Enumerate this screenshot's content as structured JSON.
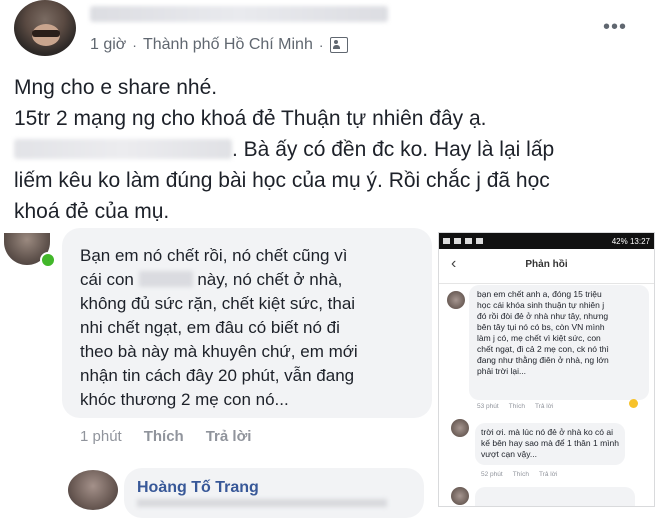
{
  "post": {
    "meta_time": "1 giờ",
    "meta_sep": "·",
    "meta_location": "Thành phố Hồ Chí Minh",
    "meta_sep2": "·",
    "more_icon": "more-dots-icon",
    "lines": [
      "Mng cho e share nhé.",
      "15tr 2 mạng ng cho khoá đẻ Thuận tự nhiên đây ạ.",
      ". Bà ấy có đền đc ko. Hay là lại lấp",
      "liếm kêu ko làm đúng bài học của mụ ý. Rồi chắc j đã học",
      "khoá đẻ của mụ."
    ]
  },
  "comment": {
    "line1": "Bạn em nó chết rồi, nó chết cũng vì",
    "line2_a": "cái con",
    "line2_b": " này, nó chết ở nhà,",
    "line3": "không đủ sức rặn, chết kiệt sức, thai",
    "line4": "nhi chết ngạt, em đâu có biết nó đi",
    "line5": "theo bà này mà khuyên chứ, em mới",
    "line6": "nhận tin cách đây 20 phút, vẫn đang",
    "line7": "khóc thương 2 mẹ con nó...",
    "time": "1 phút",
    "like": "Thích",
    "reply": "Trả lời"
  },
  "reply": {
    "name": "Hoàng Tố Trang"
  },
  "phone": {
    "status_right": "42% 13:27",
    "title": "Phản hồi",
    "c1_lines": [
      "bạn em chết anh a, đóng 15 triệu",
      "học cái khóa sinh thuận tự nhiên j",
      "đó rồi đòi đẻ ở nhà như tây, nhưng",
      "bên tây tụi nó có bs, còn VN mình",
      "làm j có, mẹ chết vì kiệt sức, con",
      "chết ngạt, đi cả 2 mẹ con, ck nó thì",
      "đang như thằng điên ở nhà, ng lớn",
      "phải trời lại..."
    ],
    "c1_time": "53 phút",
    "c1_like": "Thích",
    "c1_reply": "Trả lời",
    "c2_lines": [
      "trời ơi. mà lúc nó đẻ ở nhà ko có ai",
      "kế bên hay sao mà để 1 thân 1 mình",
      "vượt cạn vậy..."
    ],
    "c2_time": "52 phút",
    "c2_like": "Thích",
    "c2_reply": "Trả lời"
  }
}
